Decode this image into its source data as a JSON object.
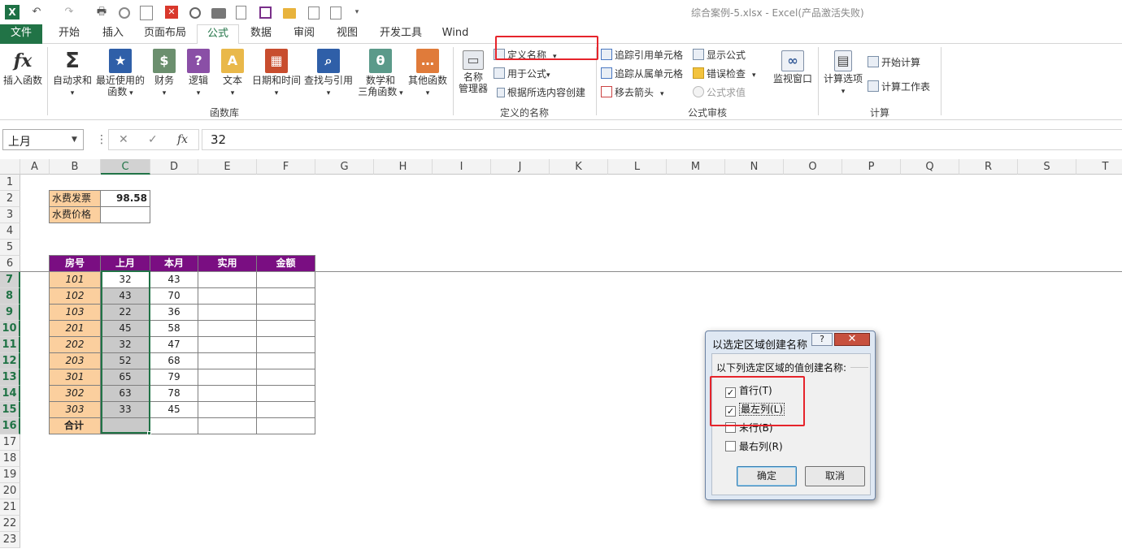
{
  "window": {
    "title": "综合案例-5.xlsx - Excel(产品激活失败)",
    "app_logo_text": "X"
  },
  "quick_access": {
    "undo": "↶",
    "redo": "↷",
    "print": "🖶"
  },
  "ribbon_tabs": [
    "文件",
    "开始",
    "插入",
    "页面布局",
    "公式",
    "数据",
    "审阅",
    "视图",
    "开发工具",
    "Wind"
  ],
  "active_tab": "公式",
  "ribbon": {
    "insert_function": "插入函数",
    "fx_symbol": "fx",
    "autosum": "自动求和",
    "sigma": "Σ",
    "recent_line1": "最近使用的",
    "recent_line2": "函数",
    "financial": "财务",
    "logical": "逻辑",
    "logical_icon": "?",
    "text": "文本",
    "text_icon": "A",
    "datetime": "日期和时间",
    "lookup": "查找与引用",
    "math_line1": "数学和",
    "math_line2": "三角函数",
    "math_icon": "θ",
    "more": "其他函数",
    "group_library": "函数库",
    "name_manager_line1": "名称",
    "name_manager_line2": "管理器",
    "define_name": "定义名称",
    "use_in_formula": "用于公式",
    "create_from_selection": "根据所选内容创建",
    "group_defined_names": "定义的名称",
    "trace_precedents": "追踪引用单元格",
    "trace_dependents": "追踪从属单元格",
    "remove_arrows": "移去箭头",
    "show_formulas": "显示公式",
    "error_checking": "错误检查",
    "evaluate_formula": "公式求值",
    "group_auditing": "公式审核",
    "watch_window": "监视窗口",
    "calc_options": "计算选项",
    "calc_now": "开始计算",
    "calc_sheet": "计算工作表",
    "group_calculation": "计算"
  },
  "formula_bar": {
    "name_box": "上月",
    "cancel": "✕",
    "enter": "✓",
    "fx": "fx",
    "value": "32"
  },
  "columns": [
    "A",
    "B",
    "C",
    "D",
    "E",
    "F",
    "G",
    "H",
    "I",
    "J",
    "K",
    "L",
    "M",
    "N",
    "O",
    "P",
    "Q",
    "R",
    "S",
    "T"
  ],
  "rows": [
    "1",
    "2",
    "3",
    "4",
    "5",
    "6",
    "7",
    "8",
    "9",
    "10",
    "11",
    "12",
    "13",
    "14",
    "15",
    "16",
    "17",
    "18",
    "19",
    "20",
    "21",
    "22",
    "23"
  ],
  "sheet": {
    "b2": "水费发票",
    "c2": "98.58",
    "b3": "水费价格",
    "headers": [
      "房号",
      "上月",
      "本月",
      "实用",
      "金额"
    ],
    "data": [
      [
        "101",
        "32",
        "43"
      ],
      [
        "102",
        "43",
        "70"
      ],
      [
        "103",
        "22",
        "36"
      ],
      [
        "201",
        "45",
        "58"
      ],
      [
        "202",
        "32",
        "47"
      ],
      [
        "203",
        "52",
        "68"
      ],
      [
        "301",
        "65",
        "79"
      ],
      [
        "302",
        "63",
        "78"
      ],
      [
        "303",
        "33",
        "45"
      ]
    ],
    "total_label": "合计"
  },
  "dialog": {
    "title": "以选定区域创建名称",
    "help": "?",
    "close": "✕",
    "prompt": "以下列选定区域的值创建名称:",
    "options": [
      {
        "label": "首行(T)",
        "checked": true
      },
      {
        "label": "最左列(L)",
        "checked": true
      },
      {
        "label": "末行(B)",
        "checked": false
      },
      {
        "label": "最右列(R)",
        "checked": false
      }
    ],
    "ok": "确定",
    "cancel": "取消"
  },
  "colors": {
    "excel_green": "#217346",
    "header_purple": "#7a0e82",
    "room_orange": "#fbcf9e",
    "highlight_red": "#e6242b"
  }
}
